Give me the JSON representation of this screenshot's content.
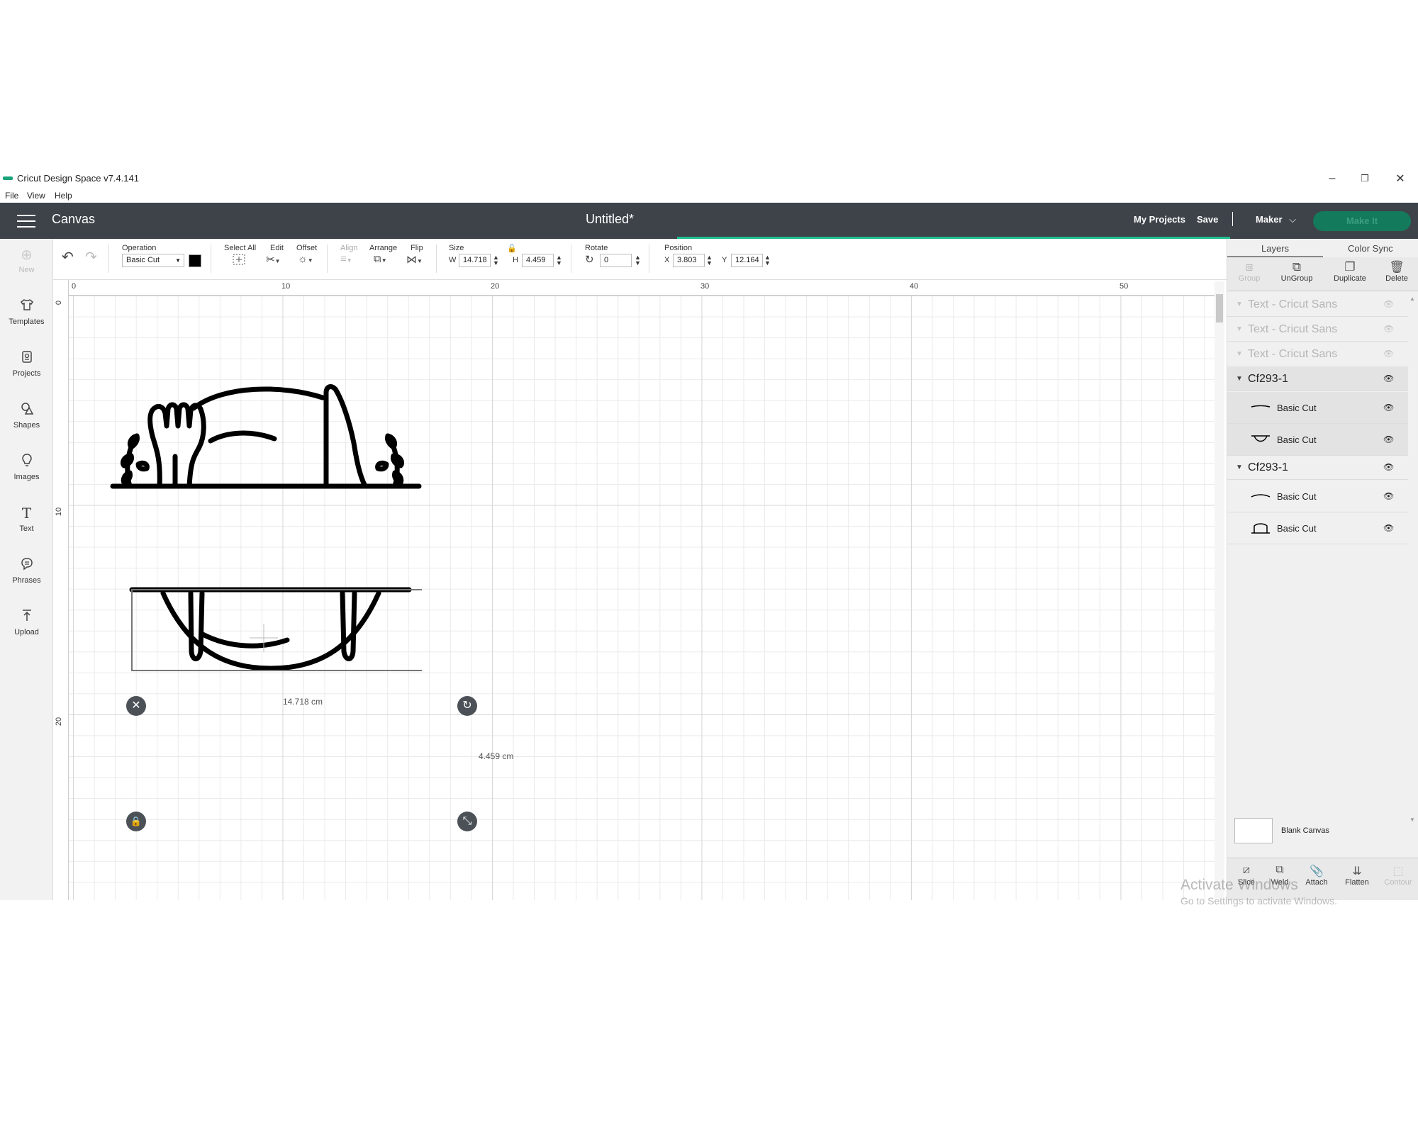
{
  "window": {
    "title": "Cricut Design Space  v7.4.141",
    "controls": {
      "minimize": "–",
      "restore": "❐",
      "close": "✕"
    }
  },
  "menu": [
    "File",
    "View",
    "Help"
  ],
  "header": {
    "app_title": "Canvas",
    "doc_title": "Untitled*",
    "my_projects": "My Projects",
    "save": "Save",
    "separator": "|",
    "machine": "Maker",
    "make_it": "Make It"
  },
  "leftnav": [
    {
      "label": "New",
      "icon": "plus-circle-icon",
      "glyph": "⊕",
      "enabled": false
    },
    {
      "label": "Templates",
      "icon": "tshirt-icon",
      "glyph": "👕",
      "enabled": true
    },
    {
      "label": "Projects",
      "icon": "projects-icon",
      "glyph": "🗒",
      "enabled": true
    },
    {
      "label": "Shapes",
      "icon": "shapes-icon",
      "glyph": "◇",
      "enabled": true
    },
    {
      "label": "Images",
      "icon": "lightbulb-icon",
      "glyph": "💡",
      "enabled": true
    },
    {
      "label": "Text",
      "icon": "text-icon",
      "glyph": "T",
      "enabled": true
    },
    {
      "label": "Phrases",
      "icon": "speech-bubble-icon",
      "glyph": "💬",
      "enabled": true
    },
    {
      "label": "Upload",
      "icon": "upload-icon",
      "glyph": "⤒",
      "enabled": true
    }
  ],
  "toolbar": {
    "operation_label": "Operation",
    "operation_value": "Basic Cut",
    "operation_color": "#000000",
    "select_all_label": "Select All",
    "edit_label": "Edit",
    "offset_label": "Offset",
    "align_label": "Align",
    "arrange_label": "Arrange",
    "flip_label": "Flip",
    "size_label": "Size",
    "w_label": "W",
    "w_value": "14.718",
    "h_label": "H",
    "h_value": "4.459",
    "rotate_label": "Rotate",
    "rotate_value": "0",
    "position_label": "Position",
    "x_label": "X",
    "x_value": "3.803",
    "y_label": "Y",
    "y_value": "12.164"
  },
  "rulers": {
    "h_ticks": [
      "0",
      "10",
      "20",
      "30",
      "40",
      "50"
    ],
    "v_ticks": [
      "0",
      "10",
      "20"
    ]
  },
  "selection": {
    "width_label": "14.718 cm",
    "height_label": "4.459 cm"
  },
  "panel": {
    "tabs": [
      "Layers",
      "Color Sync"
    ],
    "tools": [
      {
        "label": "Group",
        "icon": "group-icon",
        "enabled": false
      },
      {
        "label": "UnGroup",
        "icon": "ungroup-icon",
        "enabled": true
      },
      {
        "label": "Duplicate",
        "icon": "duplicate-icon",
        "enabled": true
      },
      {
        "label": "Delete",
        "icon": "trash-icon",
        "enabled": true
      }
    ],
    "layers": [
      {
        "name": "Text - Cricut Sans"
      },
      {
        "name": "Text - Cricut Sans"
      },
      {
        "name": "Text - Cricut Sans"
      }
    ],
    "groups": [
      {
        "name": "Cf293-1",
        "children": [
          "Basic Cut",
          "Basic Cut"
        ]
      },
      {
        "name": "Cf293-1",
        "children": [
          "Basic Cut",
          "Basic Cut"
        ]
      }
    ],
    "blank_canvas": "Blank Canvas",
    "bottom_tools": [
      {
        "label": "Slice",
        "icon": "slice-icon",
        "enabled": true
      },
      {
        "label": "Weld",
        "icon": "weld-icon",
        "enabled": true
      },
      {
        "label": "Attach",
        "icon": "paperclip-icon",
        "enabled": true
      },
      {
        "label": "Flatten",
        "icon": "flatten-icon",
        "enabled": true
      },
      {
        "label": "Contour",
        "icon": "contour-icon",
        "enabled": false
      }
    ]
  },
  "watermark": {
    "line1": "Activate Windows",
    "line2": "Go to Settings to activate Windows."
  }
}
